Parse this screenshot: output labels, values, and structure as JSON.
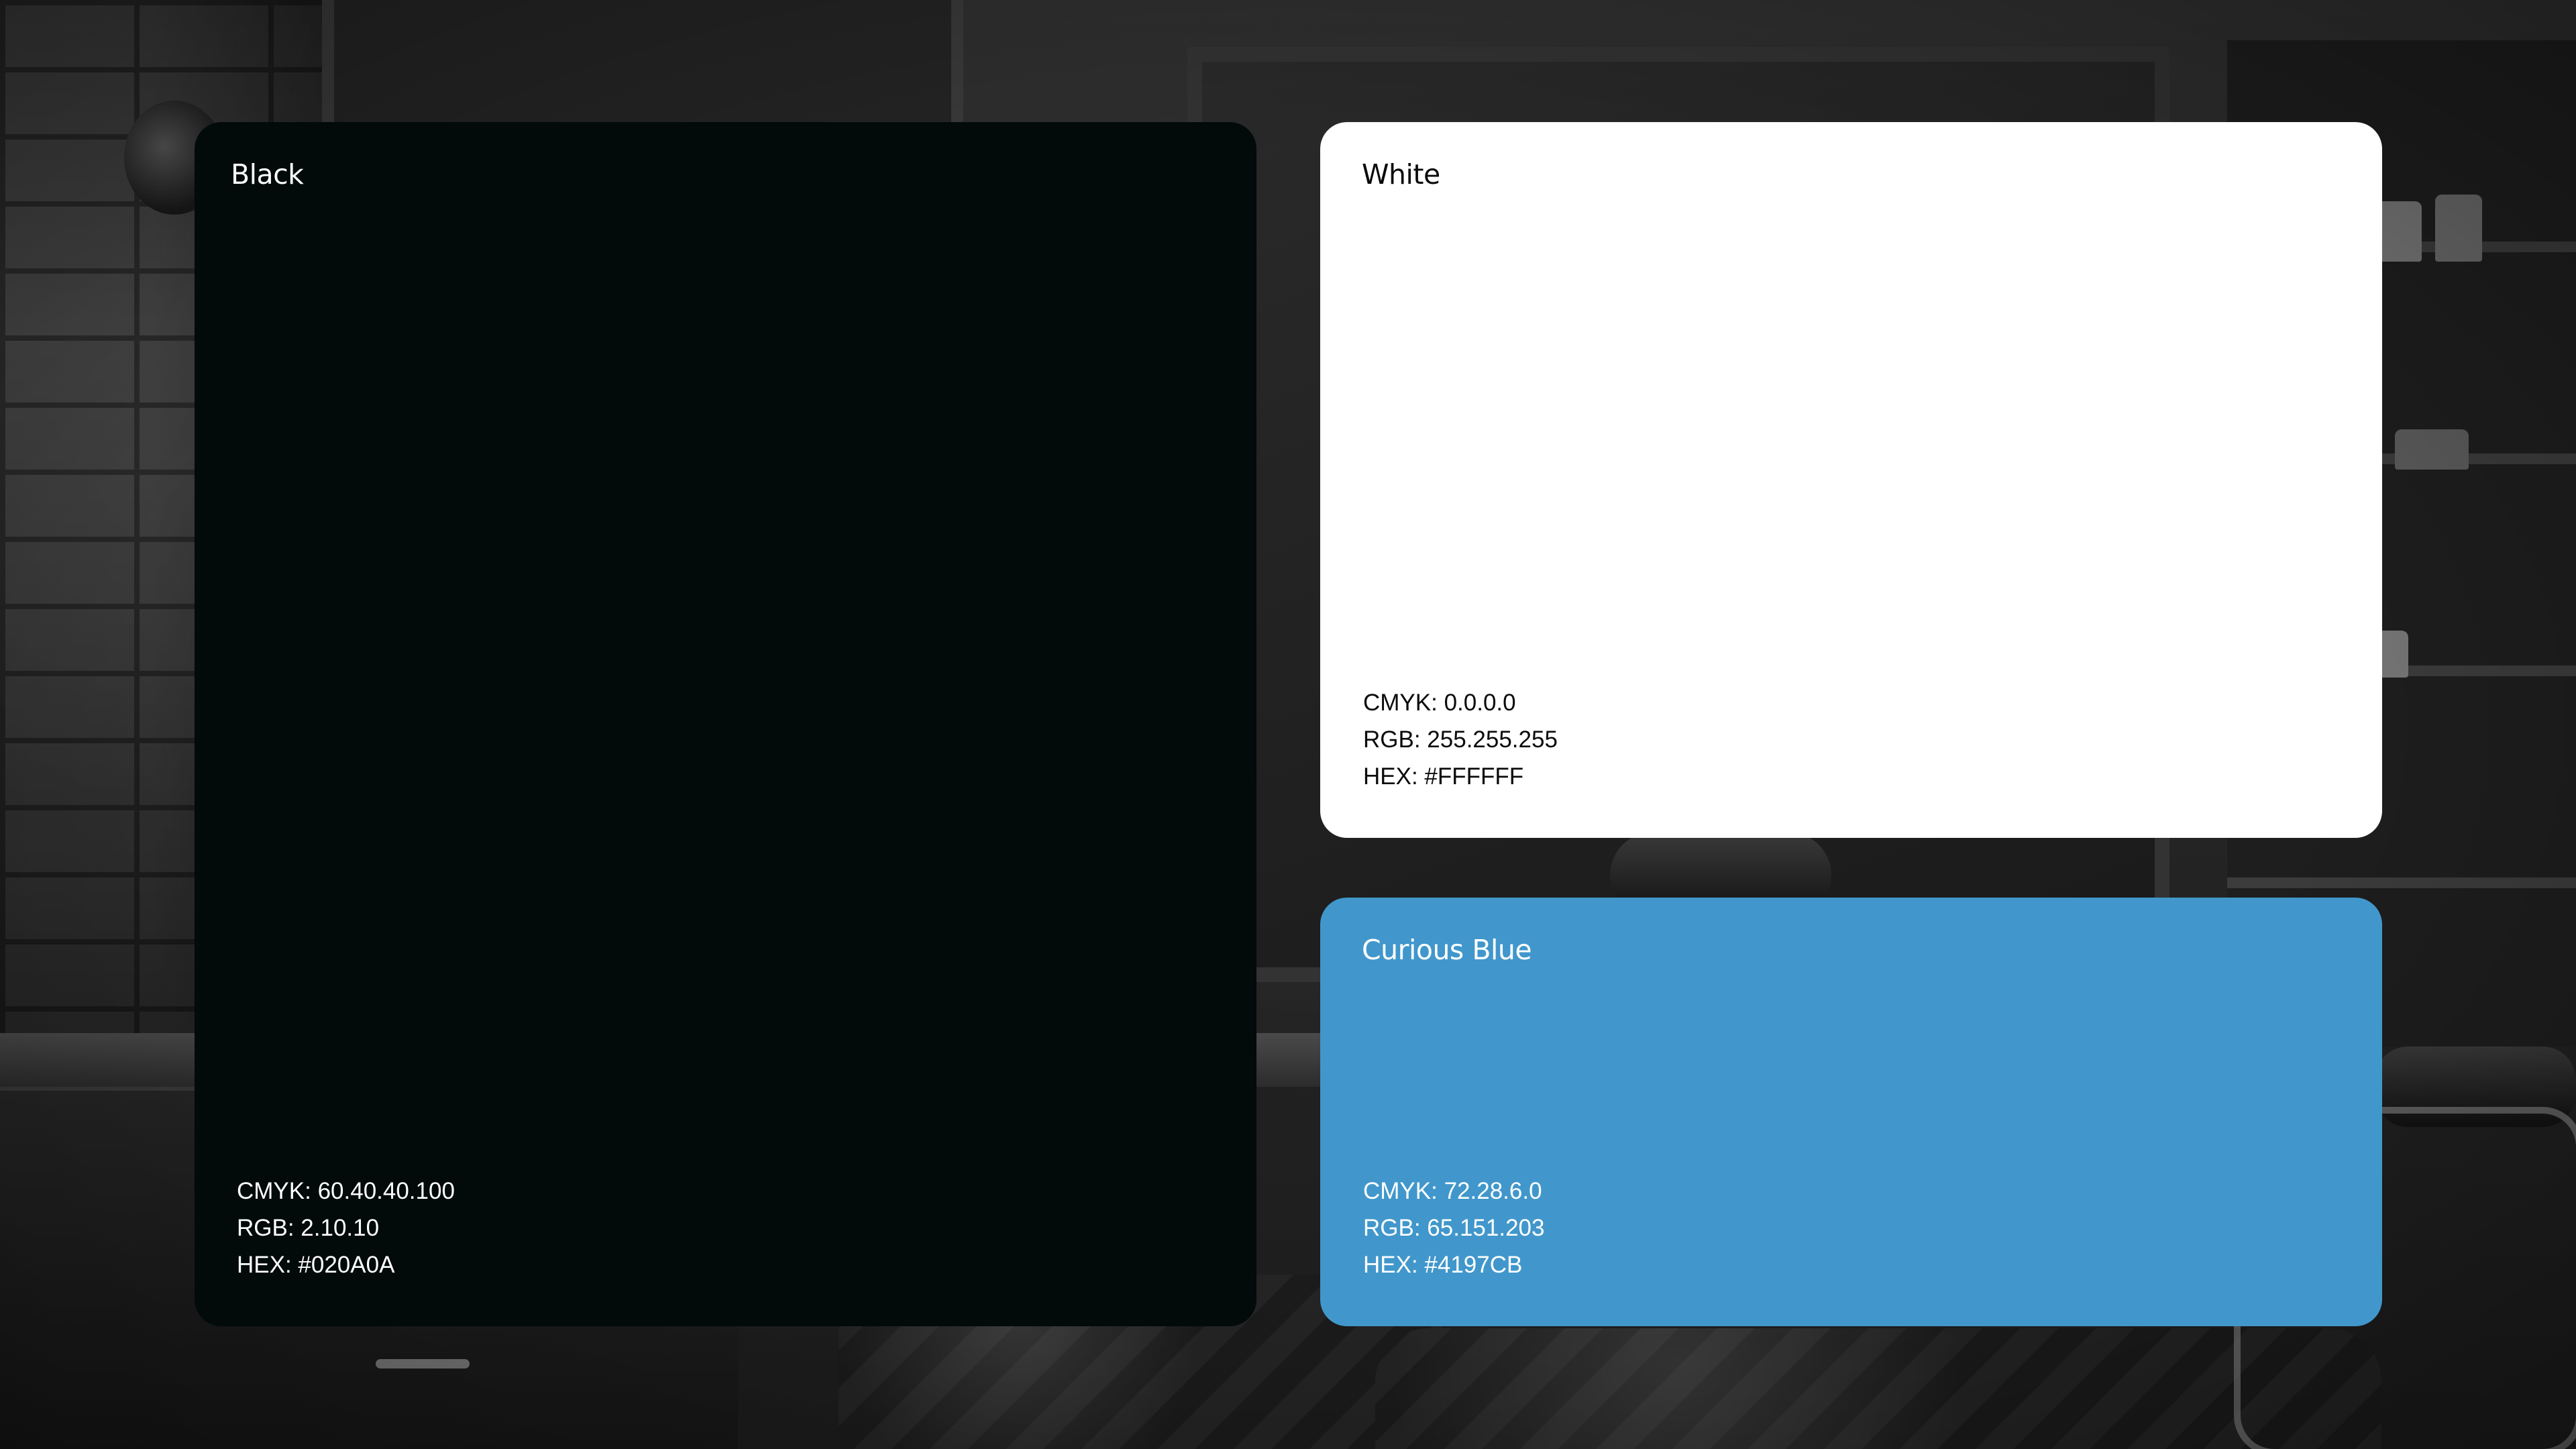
{
  "swatches": {
    "black": {
      "name": "Black",
      "cmyk": "CMYK: 60.40.40.100",
      "rgb": "RGB: 2.10.10",
      "hex": "HEX: #020A0A",
      "color": "#020A0A"
    },
    "white": {
      "name": "White",
      "cmyk": "CMYK: 0.0.0.0",
      "rgb": "RGB: 255.255.255",
      "hex": "HEX: #FFFFFF",
      "color": "#FFFFFF"
    },
    "curious_blue": {
      "name": "Curious Blue",
      "cmyk": "CMYK: 72.28.6.0",
      "rgb": "RGB: 65.151.203",
      "hex": "HEX: #4197CB",
      "color": "#4197CB"
    }
  },
  "background": {
    "description_icon": "barbershop-photo"
  }
}
